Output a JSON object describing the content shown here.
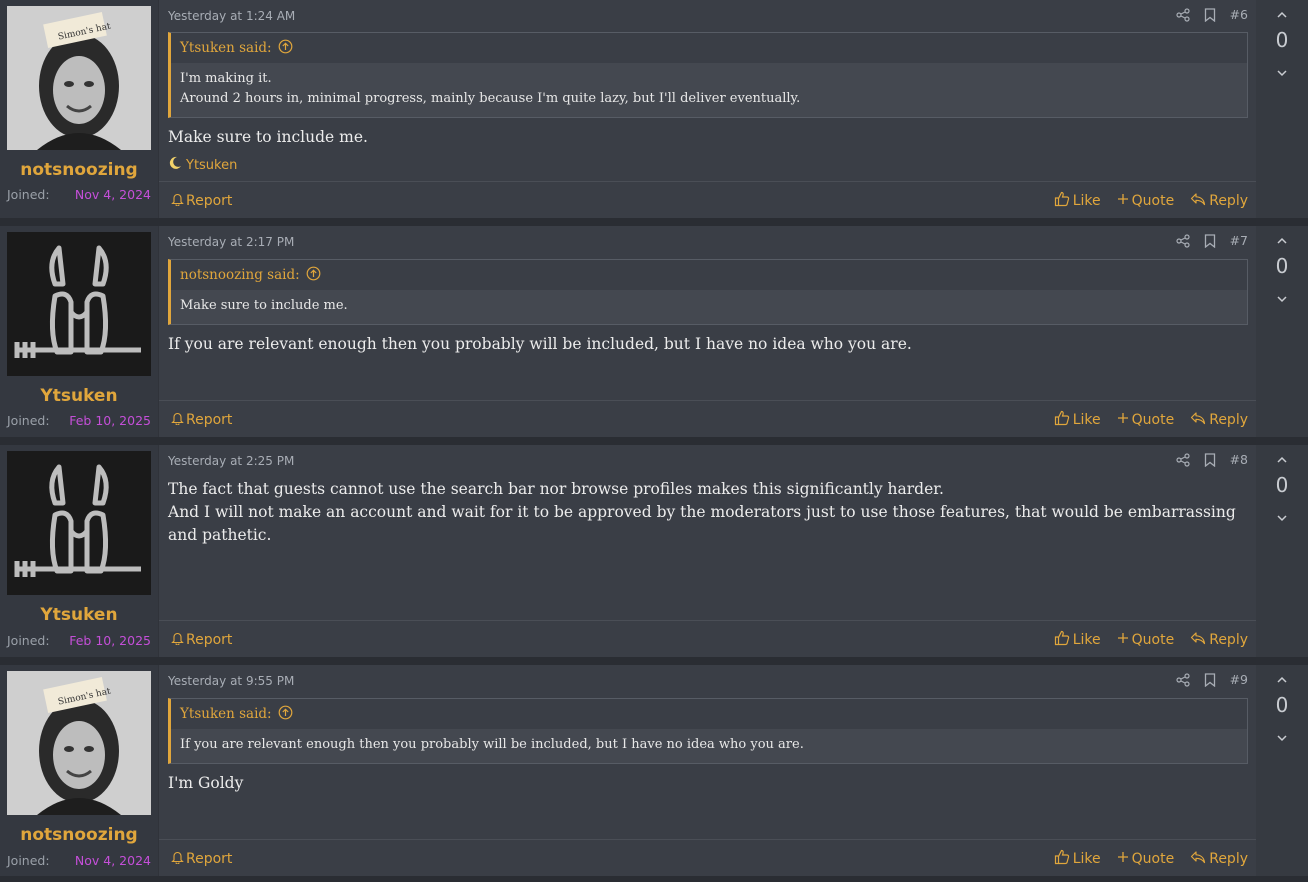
{
  "posts": [
    {
      "username": "notsnoozing",
      "joined_label": "Joined:",
      "joined_date": "Nov 4, 2024",
      "avatar": "portrait-avatar",
      "date": "Yesterday at 1:24 AM",
      "number": "#6",
      "quote": {
        "author": "Ytsuken said:",
        "lines": [
          "I'm making it.",
          "Around 2 hours in, minimal progress, mainly because I'm quite lazy, but I'll deliver eventually."
        ]
      },
      "message": [
        "Make sure to include me."
      ],
      "reaction": "Ytsuken",
      "votes": "0"
    },
    {
      "username": "Ytsuken",
      "joined_label": "Joined:",
      "joined_date": "Feb 10, 2025",
      "avatar": "emblem-avatar",
      "date": "Yesterday at 2:17 PM",
      "number": "#7",
      "quote": {
        "author": "notsnoozing said:",
        "lines": [
          "Make sure to include me."
        ]
      },
      "message": [
        "If you are relevant enough then you probably will be included, but I have no idea who you are."
      ],
      "votes": "0"
    },
    {
      "username": "Ytsuken",
      "joined_label": "Joined:",
      "joined_date": "Feb 10, 2025",
      "avatar": "emblem-avatar",
      "date": "Yesterday at 2:25 PM",
      "number": "#8",
      "message": [
        "The fact that guests cannot use the search bar nor browse profiles makes this significantly harder.",
        "And I will not make an account and wait for it to be approved by the moderators just to use those features, that would be embarrassing and pathetic."
      ],
      "votes": "0"
    },
    {
      "username": "notsnoozing",
      "joined_label": "Joined:",
      "joined_date": "Nov 4, 2024",
      "avatar": "portrait-avatar",
      "date": "Yesterday at 9:55 PM",
      "number": "#9",
      "quote": {
        "author": "Ytsuken said:",
        "lines": [
          "If you are relevant enough then you probably will be included, but I have no idea who you are."
        ]
      },
      "message": [
        "I'm Goldy"
      ],
      "votes": "0"
    }
  ],
  "labels": {
    "report": "Report",
    "like": "Like",
    "quote": "Quote",
    "reply": "Reply"
  },
  "colors": {
    "accent": "#e0a63c",
    "joined_date": "#c44fd8",
    "post_bg": "#3a3e46",
    "page_bg": "#2a2d33"
  }
}
